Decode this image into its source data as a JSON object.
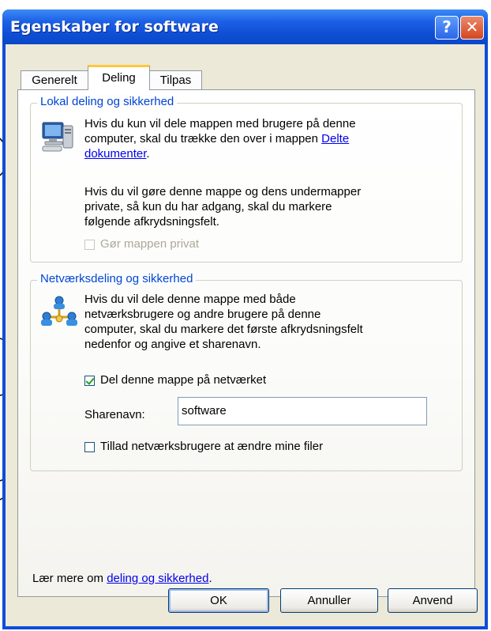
{
  "window": {
    "title": "Egenskaber for software",
    "help_label": "?",
    "close_label": "✕"
  },
  "tabs": [
    {
      "label": "Generelt",
      "selected": false
    },
    {
      "label": "Deling",
      "selected": true
    },
    {
      "label": "Tilpas",
      "selected": false
    }
  ],
  "local_sharing": {
    "group_title": "Lokal deling og sikkerhed",
    "text_1": "Hvis du kun vil dele mappen med brugere på denne",
    "text_2": "computer, skal du trække den over i mappen",
    "link_1": "Delte",
    "link_2": "dokumenter",
    "text_after_link": ".",
    "text_3": "Hvis du vil gøre denne mappe og dens undermapper",
    "text_4": "private, så kun du har adgang, skal du markere",
    "text_5": "følgende afkrydsningsfelt.",
    "private_checkbox_label": "Gør mappen privat",
    "private_checked": false,
    "private_disabled": true
  },
  "network_sharing": {
    "group_title": "Netværksdeling og sikkerhed",
    "text_1": "Hvis du vil dele denne mappe med både",
    "text_2": "netværksbrugere og andre brugere på denne",
    "text_3": "computer, skal du markere det første afkrydsningsfelt",
    "text_4": "nedenfor og angive et sharenavn.",
    "share_checkbox_label": "Del denne mappe på netværket",
    "share_checked": true,
    "share_name_label": "Sharenavn:",
    "share_name_value": "software",
    "allow_change_label": "Tillad netværksbrugere at ændre mine filer",
    "allow_change_checked": false
  },
  "learn_more": {
    "prefix": "Lær mere om ",
    "link": "deling og sikkerhed",
    "suffix": "."
  },
  "buttons": {
    "ok": "OK",
    "cancel": "Annuller",
    "apply": "Anvend"
  },
  "icons": [
    "computer-icon",
    "network-users-icon",
    "help-icon",
    "close-icon"
  ]
}
